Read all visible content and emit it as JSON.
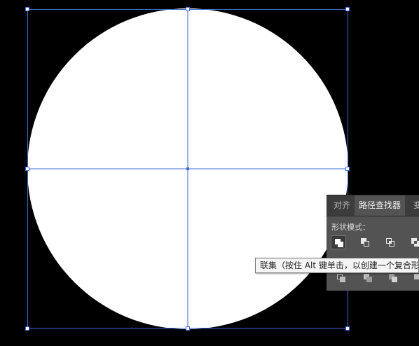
{
  "canvas": {
    "background": "#000000",
    "shape_fill": "#ffffff",
    "selection_color": "#3d6bd6"
  },
  "panel": {
    "tabs": [
      {
        "label": "对齐",
        "active": false
      },
      {
        "label": "路径查找器",
        "active": true
      },
      {
        "label": "变",
        "active": false
      }
    ],
    "shape_modes_label": "形状模式：",
    "shape_mode_buttons": [
      {
        "icon": "unite-icon",
        "selected": true
      },
      {
        "icon": "minus-front-icon",
        "selected": false
      },
      {
        "icon": "intersect-icon",
        "selected": false
      },
      {
        "icon": "exclude-icon",
        "selected": false
      }
    ],
    "pathfinder_buttons": [
      {
        "icon": "divide-icon"
      },
      {
        "icon": "trim-icon"
      },
      {
        "icon": "merge-icon"
      },
      {
        "icon": "crop-icon"
      }
    ]
  },
  "tooltip": {
    "text": "联集（按住 Alt 键单击，以创建一个复合形状）"
  }
}
